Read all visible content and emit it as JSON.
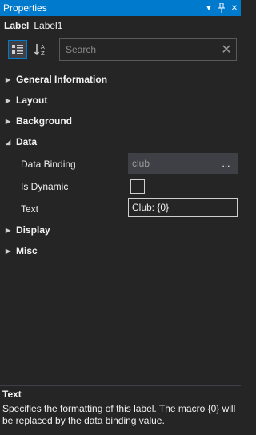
{
  "panel": {
    "title": "Properties"
  },
  "object": {
    "type": "Label",
    "name": "Label1"
  },
  "toolbar": {
    "categorized_icon": "categorized-view-icon",
    "alphabetical_icon": "sort-alphabetical-icon"
  },
  "search": {
    "placeholder": "Search",
    "value": ""
  },
  "categories": [
    {
      "label": "General Information",
      "expanded": false
    },
    {
      "label": "Layout",
      "expanded": false
    },
    {
      "label": "Background",
      "expanded": false
    },
    {
      "label": "Data",
      "expanded": true
    },
    {
      "label": "Display",
      "expanded": false
    },
    {
      "label": "Misc",
      "expanded": false
    }
  ],
  "data_props": {
    "data_binding": {
      "label": "Data Binding",
      "value": "club",
      "button": "..."
    },
    "is_dynamic": {
      "label": "Is Dynamic",
      "checked": false
    },
    "text": {
      "label": "Text",
      "value": "Club: {0}"
    }
  },
  "description": {
    "title": "Text",
    "body": "Specifies the formatting of this label. The macro {0} will be replaced by the data binding value."
  },
  "colors": {
    "accent": "#007acc",
    "background": "#252526",
    "field": "#3f3f46"
  }
}
